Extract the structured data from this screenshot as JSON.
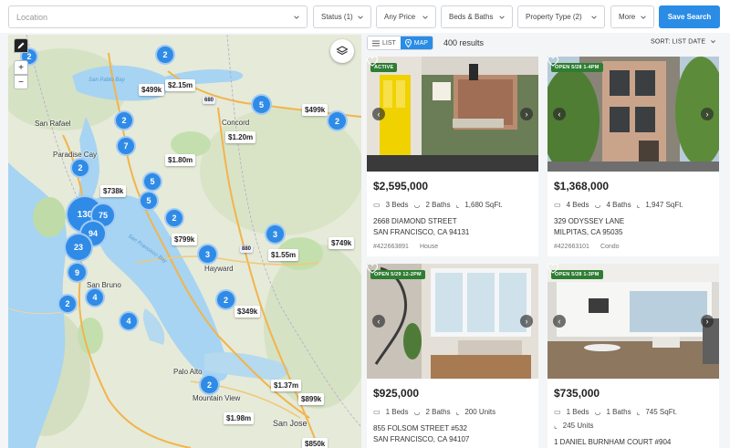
{
  "search": {
    "location_placeholder": "Location",
    "status": "Status (1)",
    "price": "Any Price",
    "beds_baths": "Beds & Baths",
    "property_type": "Property Type (2)",
    "more": "More",
    "save": "Save Search"
  },
  "view": {
    "list_label": "LIST",
    "map_label": "MAP",
    "results": "400 results",
    "sort": "SORT: LIST DATE"
  },
  "map": {
    "clusters": [
      "2",
      "2",
      "5",
      "2",
      "2",
      "7",
      "2",
      "5",
      "5",
      "2",
      "130",
      "75",
      "94",
      "23",
      "3",
      "3",
      "9",
      "4",
      "2",
      "2",
      "4",
      "2"
    ],
    "price_labels": [
      "$499k",
      "$2.15m",
      "$499k",
      "$1.20m",
      "$1.80m",
      "$738k",
      "$799k",
      "$1.55m",
      "$749k",
      "$349k",
      "$1.37m",
      "$899k",
      "$1.98m",
      "$850k"
    ],
    "cities": [
      "San Rafael",
      "Concord",
      "Paradise Cay",
      "Hayward",
      "San Bruno",
      "Palo Alto",
      "Mountain View",
      "San Jose"
    ],
    "bays": [
      "San Pablo Bay",
      "San Francisco Bay"
    ],
    "highways": [
      "680",
      "880",
      "880"
    ]
  },
  "listings": [
    {
      "badge": "ACTIVE",
      "price": "$2,595,000",
      "beds": "3 Beds",
      "baths": "2 Baths",
      "size": "1,680 SqFt.",
      "extra": "",
      "street": "2668 DIAMOND STREET",
      "city": "SAN FRANCISCO, CA 94131",
      "mls": "#422663891",
      "type": "House"
    },
    {
      "badge": "OPEN 5/28 1-4PM",
      "price": "$1,368,000",
      "beds": "4 Beds",
      "baths": "4 Baths",
      "size": "1,947 SqFt.",
      "extra": "",
      "street": "329 ODYSSEY LANE",
      "city": "MILPITAS, CA 95035",
      "mls": "#422663101",
      "type": "Condo"
    },
    {
      "badge": "OPEN 5/29 12-2PM",
      "price": "$925,000",
      "beds": "1 Beds",
      "baths": "2 Baths",
      "size": "200 Units",
      "extra": "",
      "street": "855 FOLSOM STREET #532",
      "city": "SAN FRANCISCO, CA 94107",
      "mls": "",
      "type": ""
    },
    {
      "badge": "OPEN 5/28 1-3PM",
      "price": "$735,000",
      "beds": "1 Beds",
      "baths": "1 Baths",
      "size": "745 SqFt.",
      "extra": "245 Units",
      "street": "1 DANIEL BURNHAM COURT #904",
      "city": "",
      "mls": "",
      "type": ""
    }
  ],
  "colors": {
    "accent": "#2a8ce5",
    "badge_green": "#2e7d32",
    "water": "#a7d4f2"
  }
}
